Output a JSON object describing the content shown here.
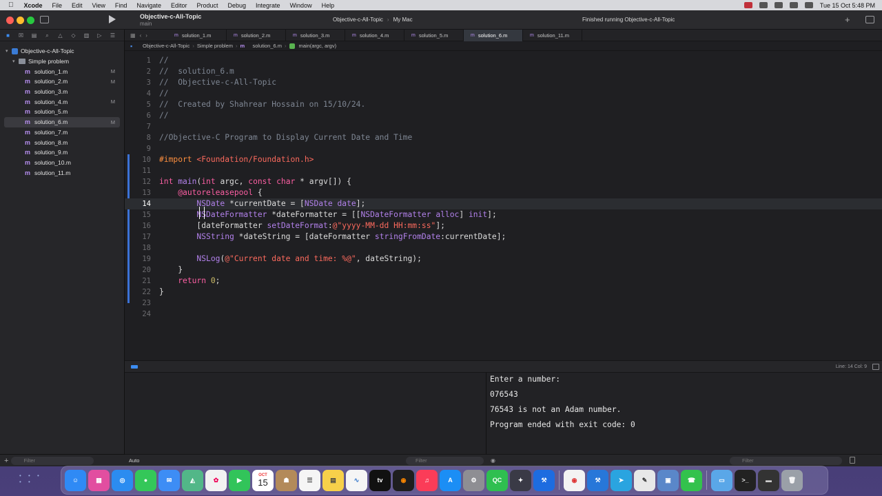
{
  "menubar": {
    "app_name": "Xcode",
    "items": [
      "File",
      "Edit",
      "View",
      "Find",
      "Navigate",
      "Editor",
      "Product",
      "Debug",
      "Integrate",
      "Window",
      "Help"
    ],
    "clock": "Tue 15 Oct  5:48 PM"
  },
  "toolbar": {
    "project_title": "Objective-c-All-Topic",
    "branch": "main",
    "scheme": "Objective-c-All-Topic",
    "destination": "My Mac",
    "status": "Finished running Objective-c-All-Topic"
  },
  "navigator": {
    "project": "Objective-c-All-Topic",
    "group": "Simple problem",
    "files": [
      {
        "name": "solution_1.m",
        "badge": "M"
      },
      {
        "name": "solution_2.m",
        "badge": "M"
      },
      {
        "name": "solution_3.m",
        "badge": ""
      },
      {
        "name": "solution_4.m",
        "badge": "M"
      },
      {
        "name": "solution_5.m",
        "badge": ""
      },
      {
        "name": "solution_6.m",
        "badge": "M"
      },
      {
        "name": "solution_7.m",
        "badge": ""
      },
      {
        "name": "solution_8.m",
        "badge": ""
      },
      {
        "name": "solution_9.m",
        "badge": ""
      },
      {
        "name": "solution_10.m",
        "badge": ""
      },
      {
        "name": "solution_11.m",
        "badge": ""
      }
    ],
    "filter_placeholder": "Filter"
  },
  "tabs": [
    "solution_1.m",
    "solution_2.m",
    "solution_3.m",
    "solution_4.m",
    "solution_5.m",
    "solution_6.m",
    "solution_11.m"
  ],
  "breadcrumb": {
    "project": "Objective-c-All-Topic",
    "group": "Simple problem",
    "file": "solution_6.m",
    "symbol": "main(argc, argv)"
  },
  "editor": {
    "current_line": 14,
    "lines": [
      {
        "n": "1",
        "t": "//"
      },
      {
        "n": "2",
        "t": "//  solution_6.m"
      },
      {
        "n": "3",
        "t": "//  Objective-c-All-Topic"
      },
      {
        "n": "4",
        "t": "//"
      },
      {
        "n": "5",
        "t": "//  Created by Shahrear Hossain on 15/10/24."
      },
      {
        "n": "6",
        "t": "//"
      },
      {
        "n": "7",
        "t": ""
      },
      {
        "n": "8",
        "t": "//Objective-C Program to Display Current Date and Time"
      },
      {
        "n": "9",
        "t": ""
      },
      {
        "n": "10",
        "t": "#import <Foundation/Foundation.h>"
      },
      {
        "n": "11",
        "t": ""
      },
      {
        "n": "12",
        "t": "int main(int argc, const char * argv[]) {"
      },
      {
        "n": "13",
        "t": "    @autoreleasepool {"
      },
      {
        "n": "14",
        "t": "        NSDate *currentDate = [NSDate date];"
      },
      {
        "n": "15",
        "t": "        NSDateFormatter *dateFormatter = [[NSDateFormatter alloc] init];"
      },
      {
        "n": "16",
        "t": "        [dateFormatter setDateFormat:@\"yyyy-MM-dd HH:mm:ss\"];"
      },
      {
        "n": "17",
        "t": "        NSString *dateString = [dateFormatter stringFromDate:currentDate];"
      },
      {
        "n": "18",
        "t": ""
      },
      {
        "n": "19",
        "t": "        NSLog(@\"Current date and time: %@\", dateString);"
      },
      {
        "n": "20",
        "t": "    }"
      },
      {
        "n": "21",
        "t": "    return 0;"
      },
      {
        "n": "22",
        "t": "}"
      },
      {
        "n": "23",
        "t": ""
      },
      {
        "n": "24",
        "t": ""
      }
    ]
  },
  "debug": {
    "position": "Line: 14  Col: 9",
    "variables_selector": "Auto",
    "variables_filter": "Filter",
    "console_filter": "Filter"
  },
  "console": {
    "lines": [
      "Enter a number:",
      "076543",
      "76543 is not an Adam number.",
      "Program ended with exit code: 0"
    ]
  },
  "dock": {
    "apps": [
      "Finder",
      "Launchpad",
      "Safari",
      "Messages",
      "Mail",
      "Maps",
      "Photos",
      "FaceTime",
      "Calendar",
      "Contacts",
      "Reminders",
      "Notes",
      "Freeform",
      "TV",
      "Instruments",
      "Music",
      "App Store",
      "System Settings",
      "QC",
      "DaVinci",
      "Xcode",
      "Chrome",
      "Xcode Beta",
      "Telegram",
      "TextEdit",
      "Preview",
      "FaceTime",
      "Folder",
      "Terminal",
      "Display",
      "Trash"
    ],
    "calendar_date": "15",
    "calendar_month": "OCT"
  }
}
